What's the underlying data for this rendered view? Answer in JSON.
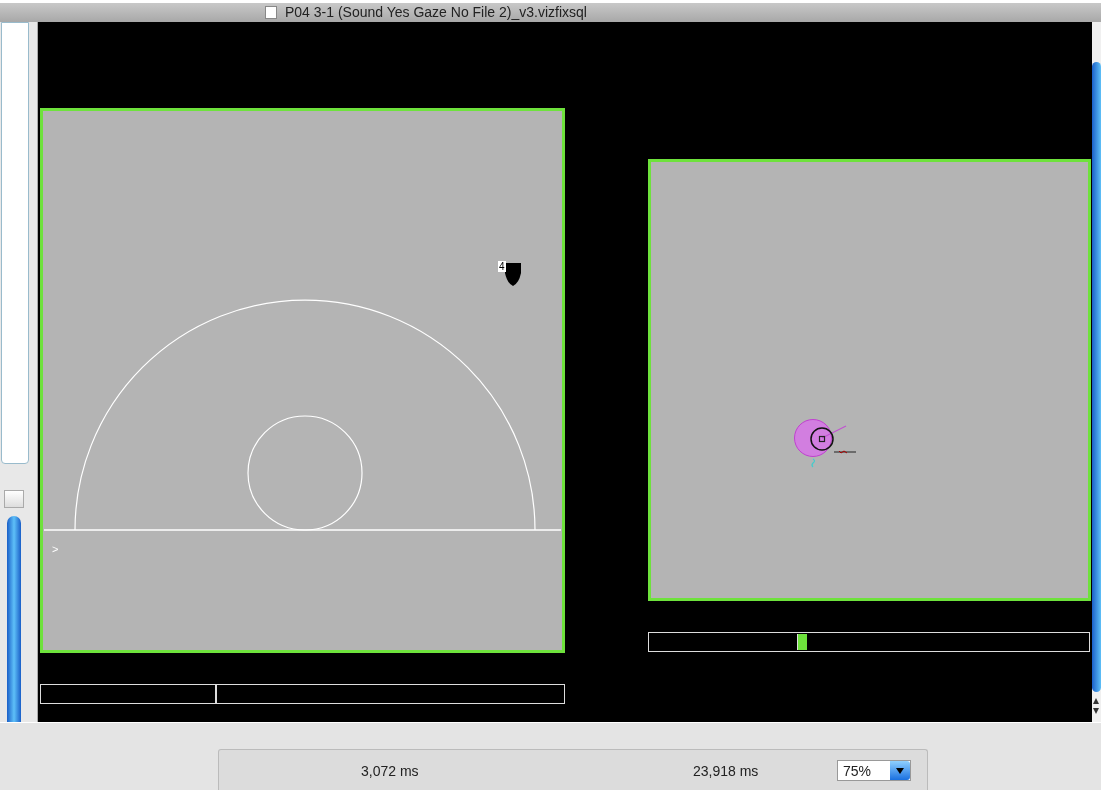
{
  "window": {
    "title": "P04 3-1 (Sound Yes Gaze No File 2)_v3.vizfixsql"
  },
  "scenes": [
    {
      "kind": "arcs",
      "marker": "4",
      "cursor": ">",
      "timeline": {
        "level": 0.333
      }
    },
    {
      "kind": "gaze",
      "timeline": {
        "level": 0.337
      }
    }
  ],
  "status_bar": {
    "start_time": "3,072 ms",
    "end_time": "23,918 ms",
    "zoom": "75%"
  }
}
